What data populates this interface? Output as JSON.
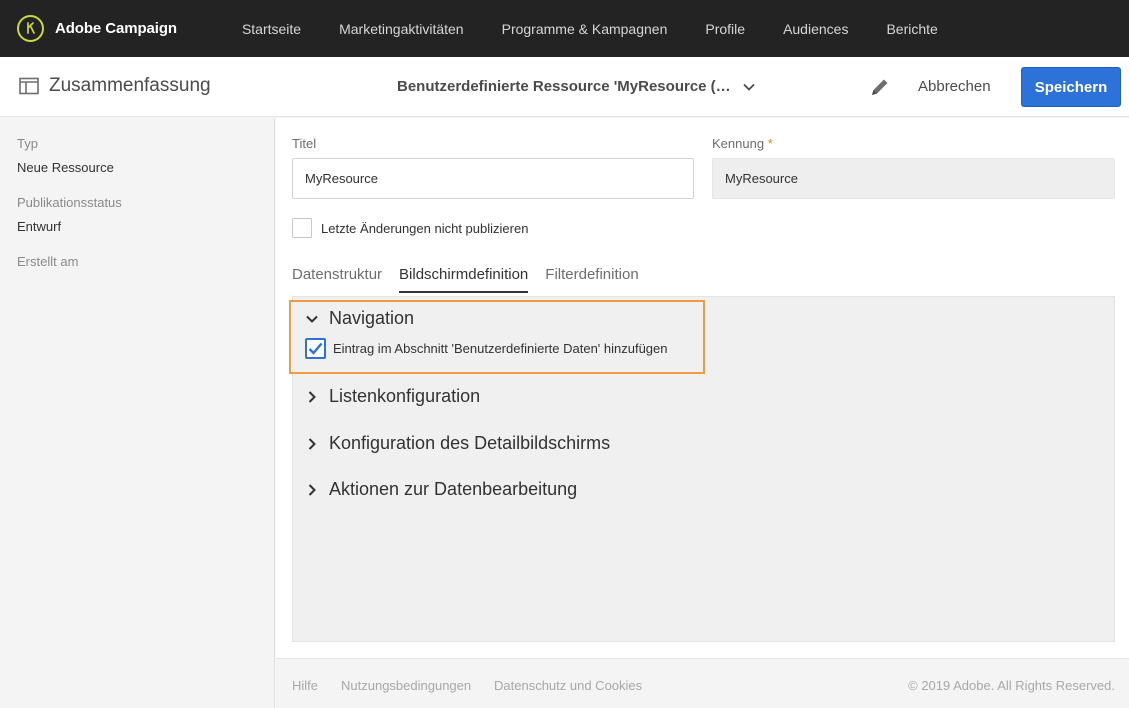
{
  "app": {
    "name": "Adobe Campaign",
    "accent_color": "#c9d93f",
    "logo_icon": "adobe-campaign-logo-icon"
  },
  "topnav": {
    "items": [
      {
        "label": "Startseite"
      },
      {
        "label": "Marketingaktivitäten"
      },
      {
        "label": "Programme & Kampagnen"
      },
      {
        "label": "Profile"
      },
      {
        "label": "Audiences"
      },
      {
        "label": "Berichte"
      }
    ]
  },
  "header": {
    "summary_label": "Zusammenfassung",
    "summary_icon": "sidebar-panel-icon",
    "resource_title": "Benutzerdefinierte Ressource 'MyResource (…",
    "edit_icon": "pencil-icon",
    "cancel_label": "Abbrechen",
    "save_label": "Speichern",
    "save_color": "#2d72d9"
  },
  "summary_panel": {
    "type_label": "Typ",
    "type_value": "Neue Ressource",
    "status_label": "Publikationsstatus",
    "status_value": "Entwurf",
    "created_label": "Erstellt am"
  },
  "form": {
    "title_label": "Titel",
    "title_value": "MyResource",
    "id_label": "Kennung",
    "id_required_mark": "*",
    "id_value": "MyResource",
    "no_publish_label": "Letzte Änderungen nicht publizieren",
    "no_publish_checked": false
  },
  "tabs": [
    {
      "label": "Datenstruktur",
      "active": false
    },
    {
      "label": "Bildschirmdefinition",
      "active": true
    },
    {
      "label": "Filterdefinition",
      "active": false
    }
  ],
  "sections": {
    "navigation": {
      "title": "Navigation",
      "expanded": true,
      "highlight_color": "#ef9b3f",
      "checkbox_label": "Eintrag im Abschnitt 'Benutzerdefinierte Daten' hinzufügen",
      "checkbox_checked": true
    },
    "list_config": {
      "title": "Listenkonfiguration",
      "expanded": false
    },
    "detail_config": {
      "title": "Konfiguration des Detailbildschirms",
      "expanded": false
    },
    "data_actions": {
      "title": "Aktionen zur Datenbearbeitung",
      "expanded": false
    }
  },
  "footer": {
    "help": "Hilfe",
    "terms": "Nutzungsbedingungen",
    "privacy": "Datenschutz und Cookies",
    "copyright": "© 2019 Adobe. All Rights Reserved."
  }
}
